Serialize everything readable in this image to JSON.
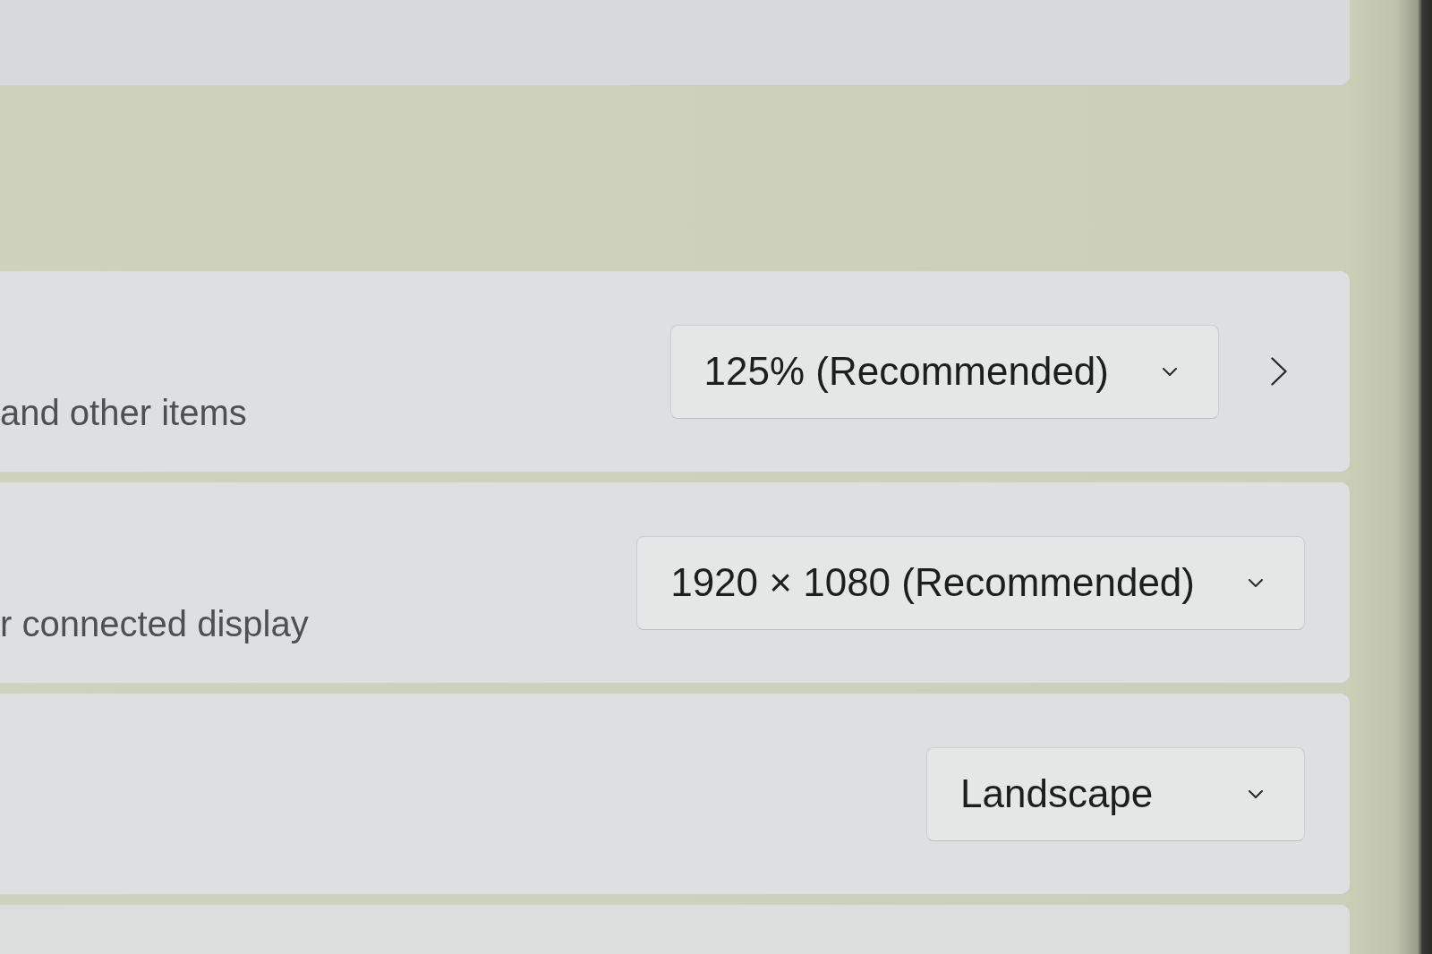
{
  "cards": [
    {
      "kind": "blank"
    },
    {
      "kind": "setting",
      "description": "and other items",
      "dropdown": "125% (Recommended)",
      "chevron": true
    },
    {
      "kind": "setting",
      "description": "r connected display",
      "dropdown": "1920 × 1080 (Recommended)",
      "chevron": false
    },
    {
      "kind": "setting",
      "dropdown": "Landscape",
      "chevron": false
    },
    {
      "kind": "blank"
    }
  ]
}
